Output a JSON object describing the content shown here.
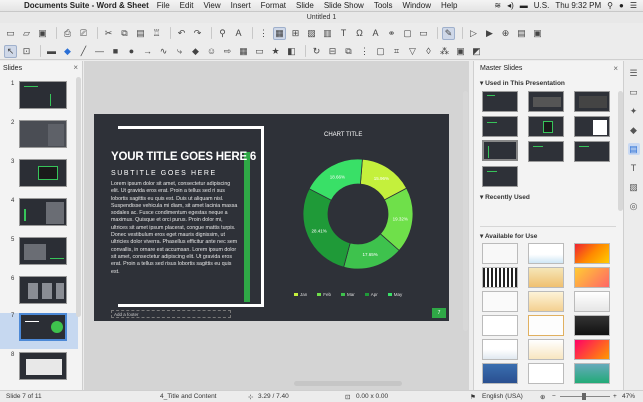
{
  "menubar": {
    "app_name": "Documents Suite - Word & Sheet",
    "items": [
      "File",
      "Edit",
      "View",
      "Insert",
      "Format",
      "Slide",
      "Slide Show",
      "Tools",
      "Window",
      "Help"
    ],
    "input_source": "U.S.",
    "clock": "Thu 9:32 PM"
  },
  "window": {
    "title": "Untitled 1"
  },
  "slides_panel": {
    "title": "Slides",
    "slide_numbers": [
      "1",
      "2",
      "3",
      "4",
      "5",
      "6",
      "7",
      "8"
    ]
  },
  "slide": {
    "title": "YOUR TITLE GOES HERE 6",
    "subtitle": "SUBTITLE GOES HERE",
    "body": "Lorem ipsum dolor sit amet, consectetur adipiscing elit. Ut gravida eros erat. Proin a tellus sed ri sus lobortis sagittis eu quis est. Duis ut aliquam nisl. Suspendisse vehicula mi diam, sit amet lacinia massa sodales ac. Fusce condimentum egestas neque a maximus. Quisque et orci purus. Proin dolor mi, ultrices sit amet ipsum placerat, congue mattis turpis. Donec vestibulum eros eget mauris dignissim, ut ultricies dolor viverra. Phasellus efficitur ante nec sem convallis, in ornare est accumsan. Lorem ipsum dolor sit amet, consectetur adipiscing elit. Ut gravida eros erat. Proin a tellus sed risus lobortis sagittis eu quis est.",
    "footer_placeholder": "Add a footer",
    "page_number": "7"
  },
  "chart_data": {
    "type": "pie",
    "title": "CHART TITLE",
    "categories": [
      "Jan",
      "Feb",
      "Mar",
      "Apr",
      "May"
    ],
    "values": [
      15.96,
      19.32,
      17.65,
      28.41,
      18.66
    ],
    "value_labels": [
      "15.96%",
      "19.32%",
      "17.65%",
      "28.41%",
      "18.66%"
    ],
    "colors": [
      "#c4f03c",
      "#6fe04a",
      "#3ec24d",
      "#1f9a38",
      "#39e067"
    ],
    "legend_position": "bottom"
  },
  "master_panel": {
    "title": "Master Slides",
    "section_used": "Used in This Presentation",
    "section_recent": "Recently Used",
    "section_available": "Available for Use"
  },
  "statusbar": {
    "slide_info": "Slide 7 of 11",
    "layout_name": "4_Title and Content",
    "position": "3.29 / 7.40",
    "size": "0.00 x 0.00",
    "language": "English (USA)",
    "zoom": "47%"
  }
}
